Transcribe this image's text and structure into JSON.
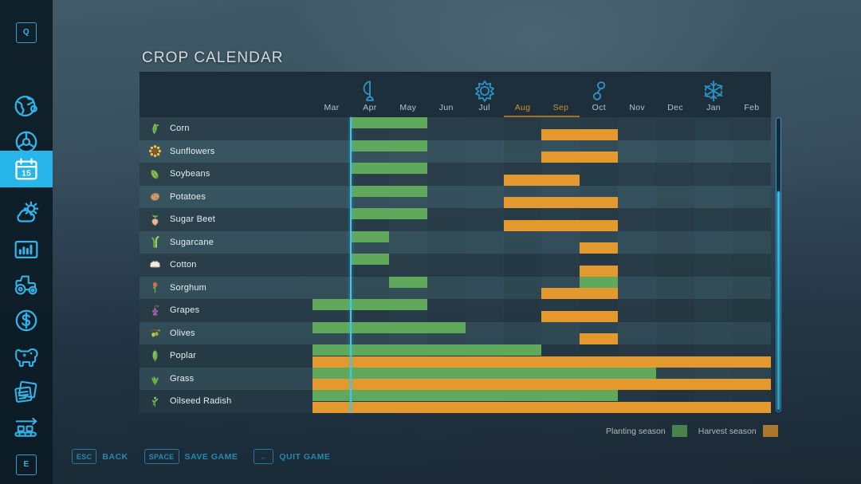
{
  "page_title": "CROP CALENDAR",
  "colors": {
    "planting": "#5fa85c",
    "harvest": "#e3992e",
    "accent": "#34b3e8",
    "cursor": "#3fc6ef",
    "row_odd": "#2d434e",
    "row_even": "#3a5763",
    "header_band": "#1f313d"
  },
  "sidebar": {
    "items": [
      {
        "icon": "q-key-icon",
        "label": "Q",
        "active": false,
        "type": "key"
      },
      {
        "icon": "globe-icon",
        "label": "Map",
        "active": false,
        "type": "icon"
      },
      {
        "icon": "steering-wheel-icon",
        "label": "Vehicles",
        "active": false,
        "type": "icon"
      },
      {
        "icon": "calendar-icon",
        "label": "Calendar",
        "active": true,
        "type": "icon"
      },
      {
        "icon": "weather-icon",
        "label": "Weather",
        "active": false,
        "type": "icon"
      },
      {
        "icon": "statistics-icon",
        "label": "Statistics",
        "active": false,
        "type": "icon"
      },
      {
        "icon": "tractor-icon",
        "label": "Vehicle Overview",
        "active": false,
        "type": "icon"
      },
      {
        "icon": "finances-icon",
        "label": "Finances",
        "active": false,
        "type": "icon"
      },
      {
        "icon": "animals-icon",
        "label": "Animals",
        "active": false,
        "type": "icon"
      },
      {
        "icon": "contracts-icon",
        "label": "Contracts",
        "active": false,
        "type": "icon"
      },
      {
        "icon": "production-icon",
        "label": "Production",
        "active": false,
        "type": "icon"
      },
      {
        "icon": "e-key-icon",
        "label": "E",
        "active": false,
        "type": "key"
      }
    ],
    "calendar_day": "15"
  },
  "calendar": {
    "months": [
      "Mar",
      "Apr",
      "May",
      "Jun",
      "Jul",
      "Aug",
      "Sep",
      "Oct",
      "Nov",
      "Dec",
      "Jan",
      "Feb"
    ],
    "current_months": [
      "Aug",
      "Sep"
    ],
    "current_month_index": 5,
    "season_icons": [
      {
        "name": "spring-sprout-icon",
        "month_index": 1
      },
      {
        "name": "summer-sun-icon",
        "month_index": 4
      },
      {
        "name": "autumn-leaf-icon",
        "month_index": 7
      },
      {
        "name": "winter-snowflake-icon",
        "month_index": 10
      }
    ],
    "crops": [
      {
        "name": "Corn",
        "icon": "corn-icon",
        "planting": [
          [
            1,
            2
          ]
        ],
        "harvest": [
          [
            6,
            7
          ]
        ]
      },
      {
        "name": "Sunflowers",
        "icon": "sunflower-icon",
        "planting": [
          [
            1,
            2
          ]
        ],
        "harvest": [
          [
            6,
            7
          ]
        ]
      },
      {
        "name": "Soybeans",
        "icon": "soybean-icon",
        "planting": [
          [
            1,
            2
          ]
        ],
        "harvest": [
          [
            5,
            6
          ]
        ]
      },
      {
        "name": "Potatoes",
        "icon": "potato-icon",
        "planting": [
          [
            1,
            2
          ]
        ],
        "harvest": [
          [
            5,
            7
          ]
        ]
      },
      {
        "name": "Sugar Beet",
        "icon": "sugarbeet-icon",
        "planting": [
          [
            1,
            2
          ]
        ],
        "harvest": [
          [
            5,
            7
          ]
        ]
      },
      {
        "name": "Sugarcane",
        "icon": "sugarcane-icon",
        "planting": [
          [
            1,
            1
          ]
        ],
        "harvest": [
          [
            7,
            7
          ]
        ]
      },
      {
        "name": "Cotton",
        "icon": "cotton-icon",
        "planting": [
          [
            1,
            1
          ]
        ],
        "harvest": [
          [
            7,
            7
          ]
        ]
      },
      {
        "name": "Sorghum",
        "icon": "sorghum-icon",
        "planting": [
          [
            2,
            2
          ],
          [
            7,
            7
          ]
        ],
        "harvest": [
          [
            6,
            7
          ]
        ]
      },
      {
        "name": "Grapes",
        "icon": "grapes-icon",
        "planting": [
          [
            0,
            2
          ]
        ],
        "harvest": [
          [
            6,
            7
          ]
        ]
      },
      {
        "name": "Olives",
        "icon": "olives-icon",
        "planting": [
          [
            0,
            3
          ]
        ],
        "harvest": [
          [
            7,
            7
          ]
        ]
      },
      {
        "name": "Poplar",
        "icon": "poplar-icon",
        "planting": [
          [
            0,
            5
          ]
        ],
        "harvest": [
          [
            0,
            11
          ]
        ]
      },
      {
        "name": "Grass",
        "icon": "grass-icon",
        "planting": [
          [
            0,
            8
          ]
        ],
        "harvest": [
          [
            0,
            11
          ]
        ]
      },
      {
        "name": "Oilseed Radish",
        "icon": "oilseed-radish-icon",
        "planting": [
          [
            0,
            7
          ]
        ],
        "harvest": [
          [
            0,
            11
          ]
        ]
      }
    ]
  },
  "legend": {
    "planting_label": "Planting season",
    "harvest_label": "Harvest season"
  },
  "bottom_bar": [
    {
      "key": "ESC",
      "label": "BACK",
      "icon": "esc-key-icon"
    },
    {
      "key": "SPACE",
      "label": "SAVE GAME",
      "icon": "space-key-icon"
    },
    {
      "key": "←",
      "label": "QUIT GAME",
      "icon": "backspace-key-icon"
    }
  ]
}
